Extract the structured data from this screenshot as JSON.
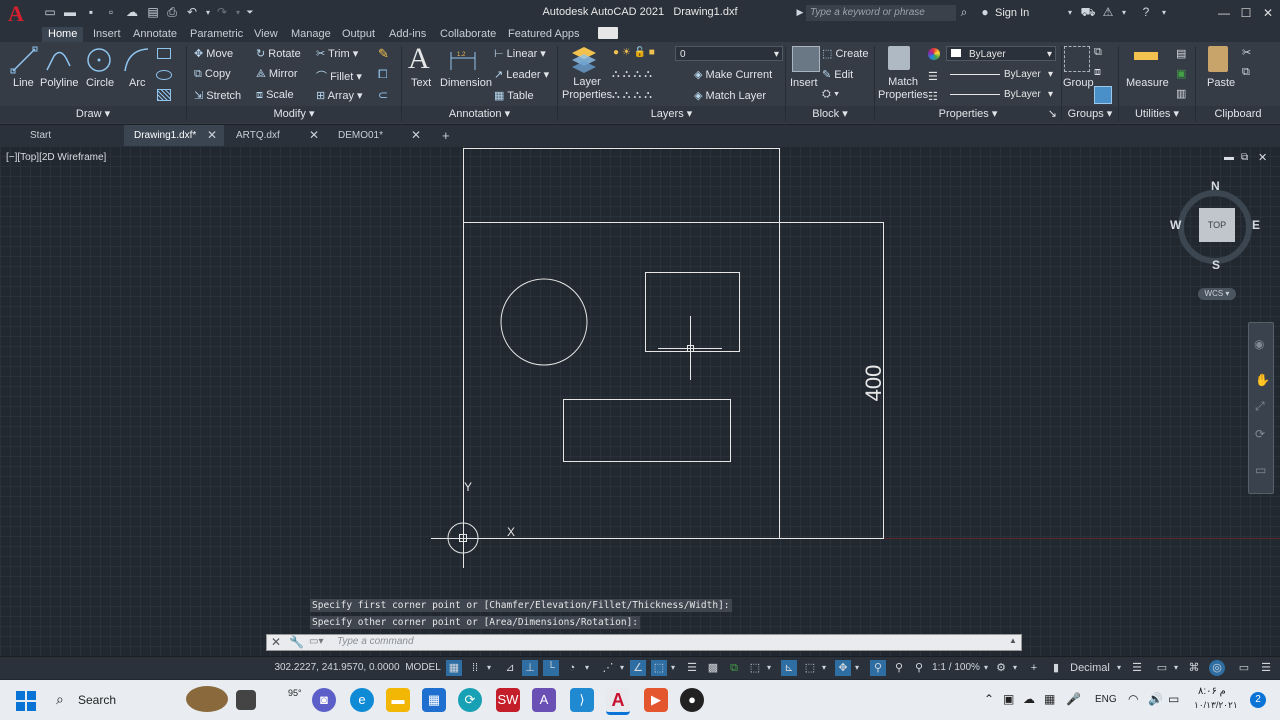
{
  "titlebar": {
    "app_title": "Autodesk AutoCAD 2021",
    "file_title": "Drawing1.dxf",
    "search_placeholder": "Type a keyword or phrase",
    "sign_in": "Sign In"
  },
  "menu_tabs": [
    "Home",
    "Insert",
    "Annotate",
    "Parametric",
    "View",
    "Manage",
    "Output",
    "Add-ins",
    "Collaborate",
    "Featured Apps"
  ],
  "ribbon": {
    "draw": {
      "line": "Line",
      "polyline": "Polyline",
      "circle": "Circle",
      "arc": "Arc",
      "panel": "Draw"
    },
    "modify": {
      "move": "Move",
      "rotate": "Rotate",
      "trim": "Trim",
      "copy": "Copy",
      "mirror": "Mirror",
      "fillet": "Fillet",
      "stretch": "Stretch",
      "scale": "Scale",
      "array": "Array",
      "panel": "Modify"
    },
    "annotation": {
      "text": "Text",
      "dimension": "Dimension",
      "linear": "Linear",
      "leader": "Leader",
      "table": "Table",
      "panel": "Annotation"
    },
    "layers": {
      "layer_properties_1": "Layer",
      "layer_properties_2": "Properties",
      "current_layer": "0",
      "make_current": "Make Current",
      "match_layer": "Match Layer",
      "panel": "Layers"
    },
    "block": {
      "insert": "Insert",
      "create": "Create",
      "edit": "Edit",
      "panel": "Block"
    },
    "properties": {
      "match_1": "Match",
      "match_2": "Properties",
      "color": "ByLayer",
      "linetype": "ByLayer",
      "lineweight": "ByLayer",
      "panel": "Properties"
    },
    "groups": {
      "group": "Group",
      "panel": "Groups"
    },
    "utilities": {
      "measure": "Measure",
      "panel": "Utilities"
    },
    "clipboard": {
      "paste": "Paste",
      "panel": "Clipboard"
    }
  },
  "file_tabs": [
    "Start",
    "Drawing1.dxf*",
    "ARTQ.dxf",
    "DEMO01*"
  ],
  "viewport": {
    "label": "[−][Top][2D Wireframe]",
    "dimension_text": "400",
    "ucs_y": "Y",
    "ucs_x": "X"
  },
  "viewcube": {
    "n": "N",
    "s": "S",
    "e": "E",
    "w": "W",
    "top": "TOP",
    "wcs": "WCS"
  },
  "command": {
    "history_1": "Specify first corner point or [Chamfer/Elevation/Fillet/Thickness/Width]:",
    "history_2": "Specify other corner point or [Area/Dimensions/Rotation]:",
    "placeholder": "Type a command"
  },
  "statusbar": {
    "coords": "302.2227, 241.9570, 0.0000",
    "model": "MODEL",
    "scale": "1:1 / 100%",
    "units": "Decimal"
  },
  "taskbar": {
    "search": "Search",
    "weather": "95°",
    "lang": "ENG",
    "time": "۸:۰۶ م",
    "date": "۱۰/۱۳/۲۰۲۱",
    "notifications": "2"
  },
  "colors": {
    "accent": "#1e88e5",
    "autocad_red": "#c8102e",
    "viewport_bg": "#212830"
  }
}
